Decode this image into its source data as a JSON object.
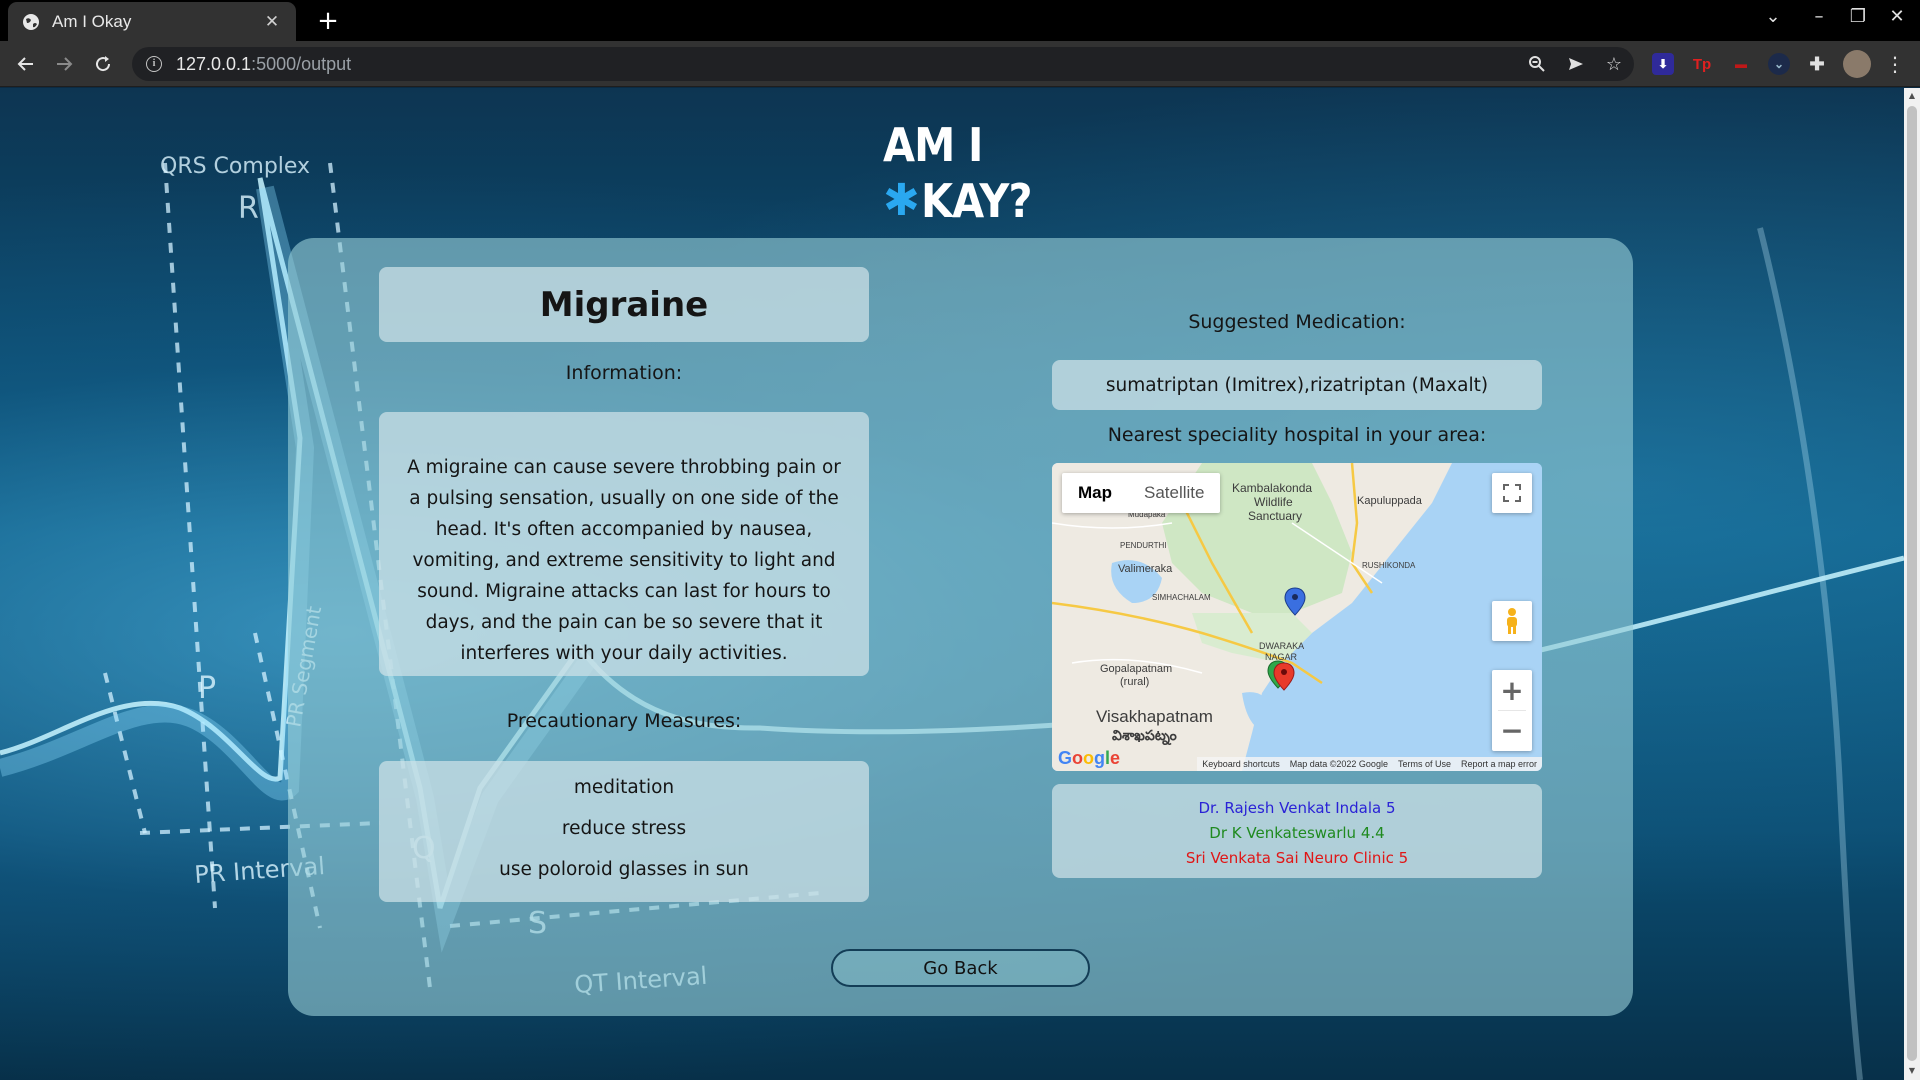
{
  "browser": {
    "tab_title": "Am I Okay",
    "url_host": "127.0.0.1",
    "url_rest": ":5000/output"
  },
  "logo": {
    "line1": "AM I",
    "line2": "KAY?"
  },
  "diagnosis": {
    "title": "Migraine",
    "information_label": "Information:",
    "information": "A migraine can cause severe throbbing pain or a pulsing sensation, usually on one side of the head. It's often accompanied by nausea, vomiting, and extreme sensitivity to light and sound. Migraine attacks can last for hours to days, and the pain can be so severe that it interferes with your daily activities.",
    "precaution_label": "Precautionary Measures:",
    "precautions": [
      "meditation",
      "reduce stress",
      "use poloroid glasses in sun"
    ]
  },
  "medication": {
    "label": "Suggested Medication:",
    "value": "sumatriptan (Imitrex),rizatriptan (Maxalt)"
  },
  "hospital": {
    "label": "Nearest speciality hospital in your area:",
    "list": [
      {
        "name": "Dr. Rajesh Venkat Indala 5",
        "color": "#2a22d6"
      },
      {
        "name": "Dr K Venkateswarlu 4.4",
        "color": "#1f8a1f"
      },
      {
        "name": "Sri Venkata Sai Neuro Clinic 5",
        "color": "#e01616"
      }
    ]
  },
  "map": {
    "type_map": "Map",
    "type_satellite": "Satellite",
    "places": {
      "kambalakonda": "Kambalakonda",
      "wildlife": "Wildlife",
      "sanctuary": "Sanctuary",
      "kapuluppada": "Kapuluppada",
      "rushikonda": "RUSHIKONDA",
      "pendurthi": "PENDURTHI",
      "valimeraka": "Valimeraka",
      "simhachalam": "SIMHACHALAM",
      "dwaraka": "DWARAKA",
      "nagar": "NAGAR",
      "gopalapatnam": "Gopalapatnam",
      "rural": "(rural)",
      "mudapaka": "Mudapaka",
      "visakhapatnam": "Visakhapatnam",
      "visakhapatnam_te": "విశాఖపట్నం"
    },
    "footer": [
      "Keyboard shortcuts",
      "Map data ©2022 Google",
      "Terms of Use",
      "Report a map error"
    ]
  },
  "go_back": "Go Back"
}
